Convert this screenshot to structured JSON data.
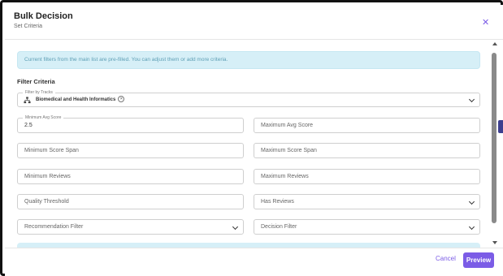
{
  "dialog": {
    "title": "Bulk Decision",
    "subtitle": "Set Criteria",
    "close_icon": "close-icon"
  },
  "info_banner": "Current filters from the main list are pre-filled. You can adjust them or add more criteria.",
  "section_title": "Filter Criteria",
  "tracks_filter": {
    "label": "Filter by Tracks",
    "icon": "tree-icon",
    "selected": "Biomedical and Health Informatics"
  },
  "fields": {
    "min_avg_score": {
      "label": "Minimum Avg Score",
      "value": "2.5"
    },
    "max_avg_score": {
      "placeholder": "Maximum Avg Score"
    },
    "min_score_span": {
      "placeholder": "Minimum Score Span"
    },
    "max_score_span": {
      "placeholder": "Maximum Score Span"
    },
    "min_reviews": {
      "placeholder": "Minimum Reviews"
    },
    "max_reviews": {
      "placeholder": "Maximum Reviews"
    },
    "quality_threshold": {
      "placeholder": "Quality Threshold"
    },
    "has_reviews": {
      "placeholder": "Has Reviews"
    },
    "recommendation_filter": {
      "placeholder": "Recommendation Filter"
    },
    "decision_filter": {
      "placeholder": "Decision Filter"
    }
  },
  "footer": {
    "cancel_label": "Cancel",
    "preview_label": "Preview"
  },
  "colors": {
    "accent": "#7b5ce6",
    "info_bg": "#d6eff7",
    "info_text": "#5e9fb5"
  }
}
